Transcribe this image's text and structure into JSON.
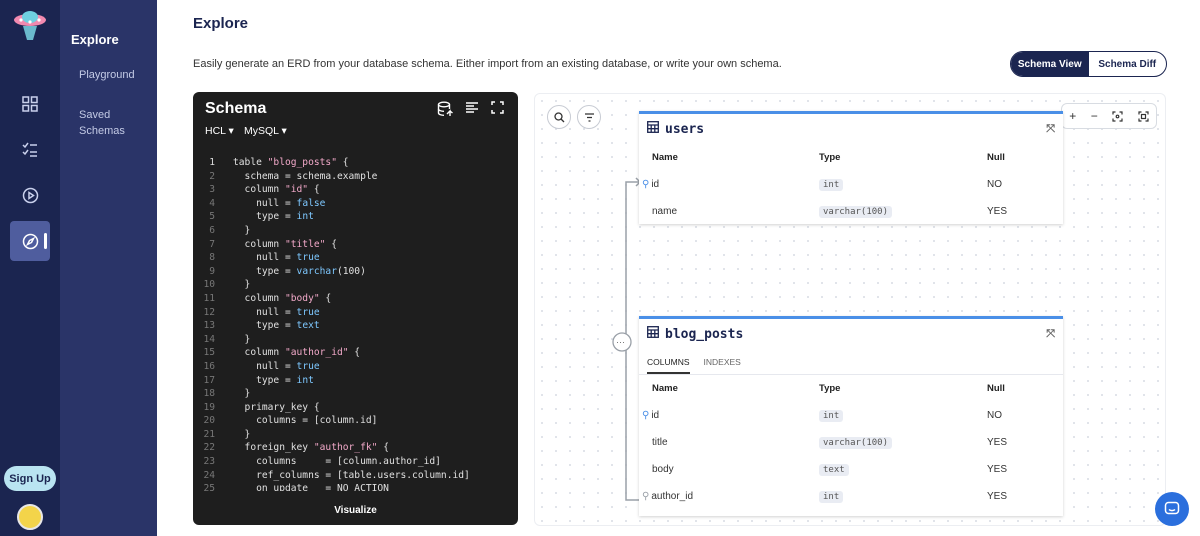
{
  "sidebar": {
    "signup_label": "Sign Up"
  },
  "subnav": {
    "title": "Explore",
    "items": [
      {
        "label": "Playground"
      },
      {
        "label": "Saved Schemas"
      }
    ]
  },
  "header": {
    "title": "Explore",
    "description": "Easily generate an ERD from your database schema. Either import from an existing database, or write your own schema.",
    "view_toggle": {
      "schema_view": "Schema View",
      "schema_diff": "Schema Diff",
      "selected": "Schema View"
    }
  },
  "editor": {
    "title": "Schema",
    "format": "HCL",
    "dialect": "MySQL",
    "visualize_label": "Visualize",
    "code": [
      {
        "n": "1",
        "t": "table \"blog_posts\" {"
      },
      {
        "n": "2",
        "t": "  schema = schema.example"
      },
      {
        "n": "3",
        "t": "  column \"id\" {"
      },
      {
        "n": "4",
        "t": "    null = false"
      },
      {
        "n": "5",
        "t": "    type = int"
      },
      {
        "n": "6",
        "t": "  }"
      },
      {
        "n": "7",
        "t": "  column \"title\" {"
      },
      {
        "n": "8",
        "t": "    null = true"
      },
      {
        "n": "9",
        "t": "    type = varchar(100)"
      },
      {
        "n": "10",
        "t": "  }"
      },
      {
        "n": "11",
        "t": "  column \"body\" {"
      },
      {
        "n": "12",
        "t": "    null = true"
      },
      {
        "n": "13",
        "t": "    type = text"
      },
      {
        "n": "14",
        "t": "  }"
      },
      {
        "n": "15",
        "t": "  column \"author_id\" {"
      },
      {
        "n": "16",
        "t": "    null = true"
      },
      {
        "n": "17",
        "t": "    type = int"
      },
      {
        "n": "18",
        "t": "  }"
      },
      {
        "n": "19",
        "t": "  primary_key {"
      },
      {
        "n": "20",
        "t": "    columns = [column.id]"
      },
      {
        "n": "21",
        "t": "  }"
      },
      {
        "n": "22",
        "t": "  foreign_key \"author_fk\" {"
      },
      {
        "n": "23",
        "t": "    columns     = [column.author_id]"
      },
      {
        "n": "24",
        "t": "    ref_columns = [table.users.column.id]"
      },
      {
        "n": "25",
        "t": "    on_update   = NO_ACTION"
      }
    ]
  },
  "erd": {
    "columns_header": {
      "name": "Name",
      "type": "Type",
      "null": "Null"
    },
    "users": {
      "name": "users",
      "rows": [
        {
          "name": "id",
          "type": "int",
          "null": "NO"
        },
        {
          "name": "name",
          "type": "varchar(100)",
          "null": "YES"
        }
      ]
    },
    "blog_posts": {
      "name": "blog_posts",
      "tabs": [
        "COLUMNS",
        "INDEXES"
      ],
      "rows": [
        {
          "name": "id",
          "type": "int",
          "null": "NO"
        },
        {
          "name": "title",
          "type": "varchar(100)",
          "null": "YES"
        },
        {
          "name": "body",
          "type": "text",
          "null": "YES"
        },
        {
          "name": "author_id",
          "type": "int",
          "null": "YES"
        }
      ]
    }
  }
}
